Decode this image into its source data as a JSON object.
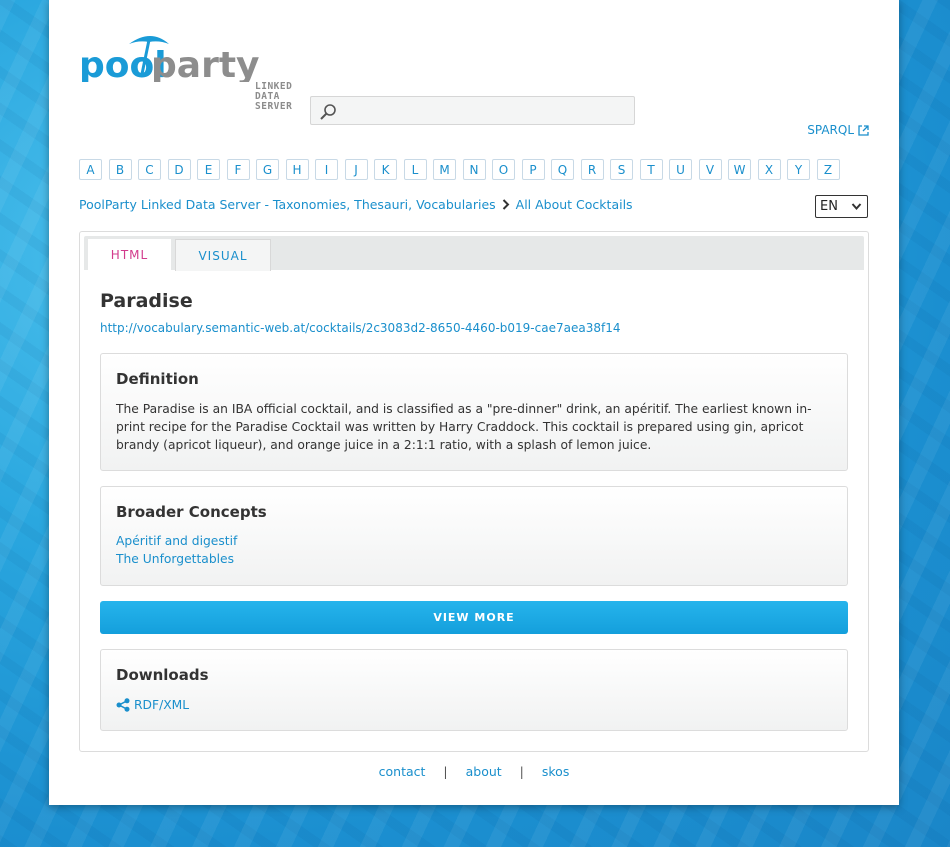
{
  "logo": {
    "name_left": "pool",
    "name_right": "party",
    "sub_line1": "LINKED DATA",
    "sub_line2": "SERVER"
  },
  "search": {
    "placeholder": "",
    "value": ""
  },
  "sparql_label": "SPARQL",
  "alphabet": [
    "A",
    "B",
    "C",
    "D",
    "E",
    "F",
    "G",
    "H",
    "I",
    "J",
    "K",
    "L",
    "M",
    "N",
    "O",
    "P",
    "Q",
    "R",
    "S",
    "T",
    "U",
    "V",
    "W",
    "X",
    "Y",
    "Z"
  ],
  "breadcrumb": {
    "root": "PoolParty Linked Data Server - Taxonomies, Thesauri, Vocabularies",
    "current": "All About Cocktails"
  },
  "language": {
    "selected": "EN"
  },
  "tabs": {
    "html": "HTML",
    "visual": "VISUAL"
  },
  "concept": {
    "title": "Paradise",
    "uri": "http://vocabulary.semantic-web.at/cocktails/2c3083d2-8650-4460-b019-cae7aea38f14"
  },
  "definition": {
    "heading": "Definition",
    "text": "The Paradise is an IBA official cocktail, and is classified as a \"pre-dinner\" drink, an apéritif. The earliest known in-print recipe for the Paradise Cocktail was written by Harry Craddock. This cocktail is prepared using gin, apricot brandy (apricot liqueur), and orange juice in a 2:1:1 ratio, with a splash of lemon juice."
  },
  "broader": {
    "heading": "Broader Concepts",
    "items": [
      "Apéritif and digestif",
      "The Unforgettables"
    ]
  },
  "view_more_label": "VIEW MORE",
  "downloads": {
    "heading": "Downloads",
    "rdf_label": "RDF/XML"
  },
  "footer": {
    "contact": "contact",
    "about": "about",
    "skos": "skos",
    "separator": "|"
  }
}
